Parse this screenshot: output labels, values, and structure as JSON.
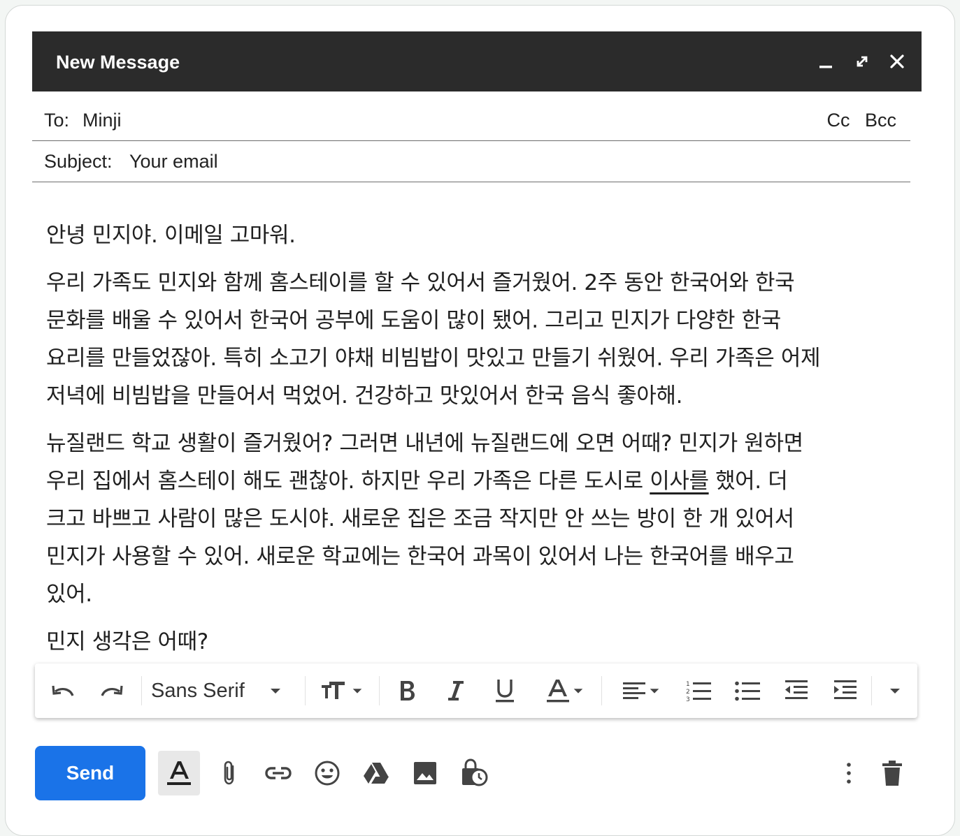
{
  "window": {
    "title": "New Message"
  },
  "recipients": {
    "to_label": "To:",
    "to_value": "Minji",
    "cc_label": "Cc",
    "bcc_label": "Bcc"
  },
  "subject": {
    "label": "Subject:",
    "value": "Your email"
  },
  "body": {
    "greeting": "안녕 민지야. 이메일 고마워.",
    "p1_lines": [
      "우리 가족도 민지와 함께 홈스테이를 할 수 있어서 즐거웠어. 2주 동안 한국어와 한국",
      "문화를 배울 수 있어서 한국어 공부에 도움이 많이 됐어. 그리고 민지가 다양한 한국",
      "요리를 만들었잖아. 특히 소고기 야채 비빔밥이 맛있고 만들기 쉬웠어. 우리 가족은 어제",
      "저녁에 비빔밥을 만들어서 먹었어. 건강하고 맛있어서 한국 음식 좋아해."
    ],
    "p2_line1": "뉴질랜드 학교 생활이 즐거웠어? 그러면 내년에 뉴질랜드에 오면 어때? 민지가 원하면",
    "p2_line2_before": "우리 집에서 홈스테이 해도 괜찮아. 하지만 우리 가족은 다른 도시로 ",
    "p2_line2_underlined": "이사를",
    "p2_line2_after": " 했어. 더",
    "p2_lines_rest": [
      "크고 바쁘고 사람이 많은 도시야. 새로운 집은 조금 작지만 안 쓰는 방이 한 개 있어서",
      "민지가 사용할 수 있어. 새로운 학교에는 한국어 과목이 있어서 나는 한국어를 배우고",
      "있어."
    ],
    "closing": "민지 생각은 어때?"
  },
  "toolbar": {
    "font_name": "Sans Serif"
  },
  "actions": {
    "send_label": "Send"
  },
  "colors": {
    "titlebar": "#2b2b2b",
    "send_button": "#1a73e8"
  }
}
